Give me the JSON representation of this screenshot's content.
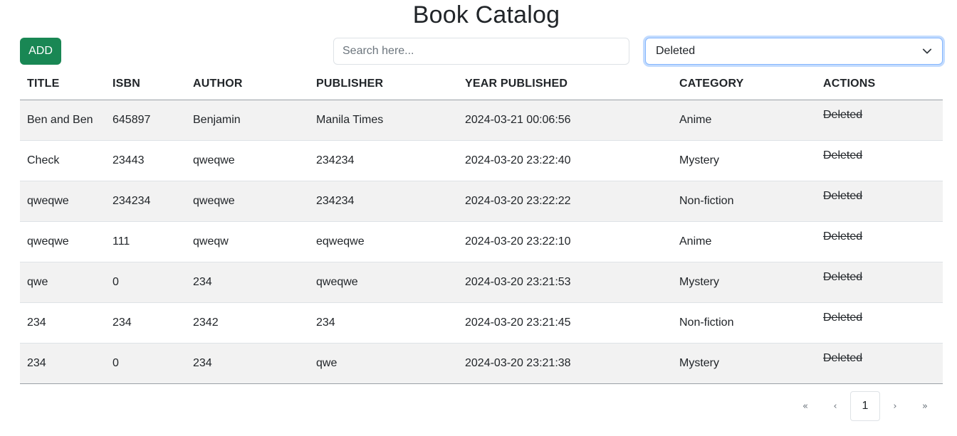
{
  "page": {
    "title": "Book Catalog"
  },
  "toolbar": {
    "add_label": "ADD",
    "search_placeholder": "Search here...",
    "filter_value": "Deleted"
  },
  "table": {
    "headers": [
      "TITLE",
      "ISBN",
      "AUTHOR",
      "PUBLISHER",
      "YEAR PUBLISHED",
      "CATEGORY",
      "ACTIONS"
    ],
    "rows": [
      {
        "title": "Ben and Ben",
        "isbn": "645897",
        "author": "Benjamin",
        "publisher": "Manila Times",
        "year": "2024-03-21 00:06:56",
        "category": "Anime",
        "action": "Deleted"
      },
      {
        "title": "Check",
        "isbn": "23443",
        "author": "qweqwe",
        "publisher": "234234",
        "year": "2024-03-20 23:22:40",
        "category": "Mystery",
        "action": "Deleted"
      },
      {
        "title": "qweqwe",
        "isbn": "234234",
        "author": "qweqwe",
        "publisher": "234234",
        "year": "2024-03-20 23:22:22",
        "category": "Non-fiction",
        "action": "Deleted"
      },
      {
        "title": "qweqwe",
        "isbn": "111",
        "author": "qweqw",
        "publisher": "eqweqwe",
        "year": "2024-03-20 23:22:10",
        "category": "Anime",
        "action": "Deleted"
      },
      {
        "title": "qwe",
        "isbn": "0",
        "author": "234",
        "publisher": "qweqwe",
        "year": "2024-03-20 23:21:53",
        "category": "Mystery",
        "action": "Deleted"
      },
      {
        "title": "234",
        "isbn": "234",
        "author": "2342",
        "publisher": "234",
        "year": "2024-03-20 23:21:45",
        "category": "Non-fiction",
        "action": "Deleted"
      },
      {
        "title": "234",
        "isbn": "0",
        "author": "234",
        "publisher": "qwe",
        "year": "2024-03-20 23:21:38",
        "category": "Mystery",
        "action": "Deleted"
      }
    ]
  },
  "pagination": {
    "first": "«",
    "prev": "‹",
    "current": "1",
    "next": "›",
    "last": "»"
  }
}
